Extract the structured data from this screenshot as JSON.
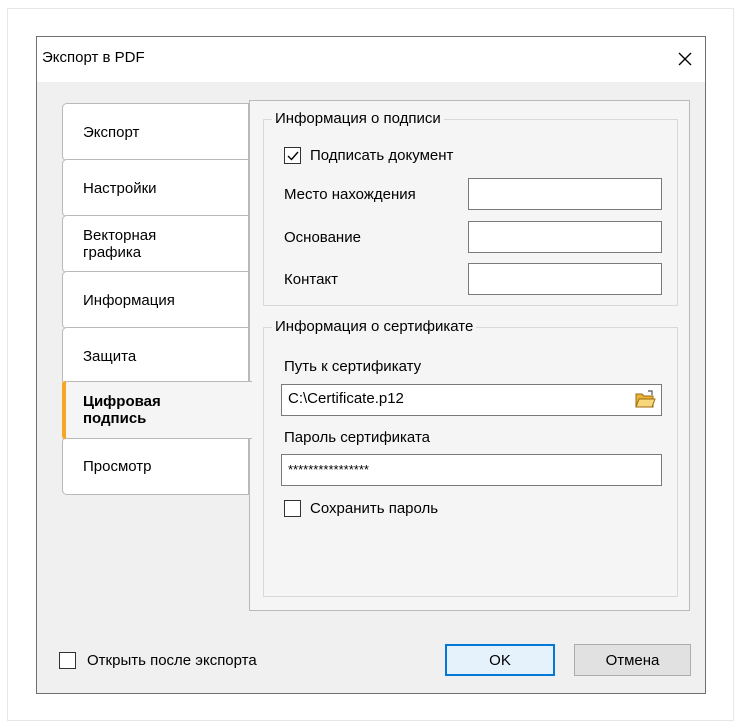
{
  "window": {
    "title": "Экспорт в PDF"
  },
  "tabs": [
    {
      "label": "Экспорт",
      "active": false
    },
    {
      "label": "Настройки",
      "active": false
    },
    {
      "label": "Векторная графика",
      "active": false
    },
    {
      "label": "Информация",
      "active": false
    },
    {
      "label": "Защита",
      "active": false
    },
    {
      "label": "Цифровая подпись",
      "active": true
    },
    {
      "label": "Просмотр",
      "active": false
    }
  ],
  "signature_info": {
    "legend": "Информация о подписи",
    "sign_document_label": "Подписать документ",
    "sign_document_checked": true,
    "location_label": "Место нахождения",
    "location_value": "",
    "reason_label": "Основание",
    "reason_value": "",
    "contact_label": "Контакт",
    "contact_value": ""
  },
  "certificate_info": {
    "legend": "Информация о сертификате",
    "path_label": "Путь к сертификату",
    "path_value": "C:\\Certificate.p12",
    "password_label": "Пароль сертификата",
    "password_value": "****************",
    "save_password_label": "Сохранить пароль",
    "save_password_checked": false
  },
  "footer": {
    "open_after_export_label": "Открыть после экспорта",
    "open_after_export_checked": false,
    "ok_label": "OK",
    "cancel_label": "Отмена"
  },
  "colors": {
    "active_tab_accent": "#f5a623",
    "default_button_border": "#0078d7"
  }
}
